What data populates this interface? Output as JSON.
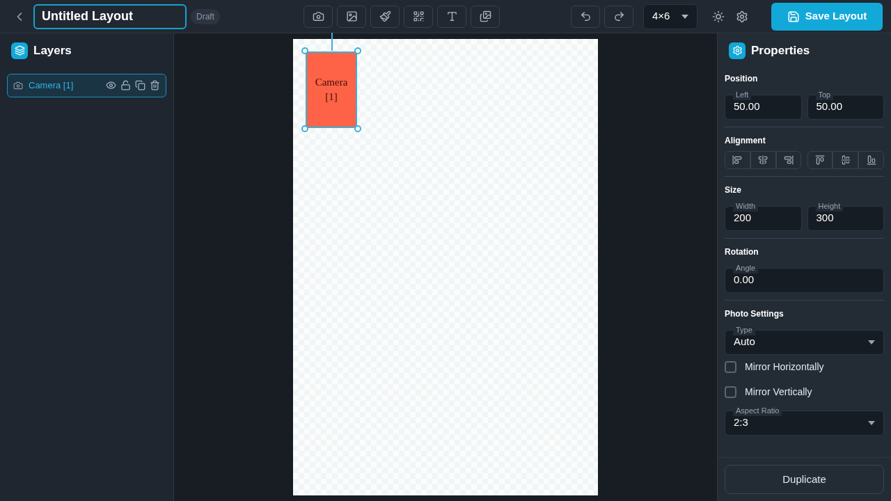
{
  "header": {
    "title": "Untitled Layout",
    "badge": "Draft",
    "size_select": "4×6",
    "save_button": "Save Layout"
  },
  "layers": {
    "title": "Layers",
    "items": [
      {
        "name": "Camera [1]",
        "selected": true
      }
    ]
  },
  "canvas": {
    "elements": [
      {
        "label": "Camera [1]",
        "selected": true
      }
    ]
  },
  "properties": {
    "title": "Properties",
    "position": {
      "title": "Position",
      "fields": [
        {
          "label": "Left",
          "value": "50.00"
        },
        {
          "label": "Top",
          "value": "50.00"
        }
      ]
    },
    "alignment": {
      "title": "Alignment"
    },
    "size": {
      "title": "Size",
      "fields": [
        {
          "label": "Width",
          "value": "200"
        },
        {
          "label": "Height",
          "value": "300"
        }
      ]
    },
    "rotation": {
      "title": "Rotation",
      "field": {
        "label": "Angle",
        "value": "0.00"
      }
    },
    "photo_settings": {
      "title": "Photo Settings",
      "type": {
        "label": "Type",
        "value": "Auto"
      },
      "checkboxes": [
        {
          "label": "Mirror Horizontally",
          "checked": false
        },
        {
          "label": "Mirror Vertically",
          "checked": false
        }
      ],
      "aspect_ratio": {
        "label": "Aspect Ratio",
        "value": "2:3"
      }
    },
    "duplicate_button": "Duplicate"
  }
}
